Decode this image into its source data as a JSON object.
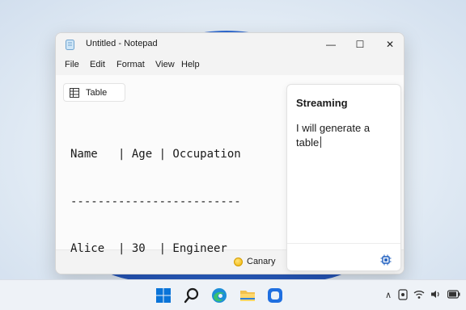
{
  "window": {
    "title": "Untitled - Notepad",
    "controls": {
      "minimize": "—",
      "maximize": "☐",
      "close": "✕"
    }
  },
  "menu": [
    "File",
    "Edit",
    "Format",
    "View",
    "Help"
  ],
  "toolbar": {
    "table_label": "Table"
  },
  "editor": {
    "lines": [
      "Name   | Age | Occupation",
      "-------------------------",
      "Alice  | 30  | Engineer"
    ]
  },
  "status": {
    "channel": "Canary"
  },
  "panel": {
    "title": "Streaming",
    "text": "I will generate a table"
  },
  "taskbar": {
    "icons": [
      "windows-start-icon",
      "search-icon",
      "edge-browser-icon",
      "file-explorer-icon",
      "copilot-app-icon"
    ],
    "tray": [
      "chevron-up-icon",
      "security-icon",
      "wifi-icon",
      "volume-icon",
      "battery-icon"
    ]
  },
  "colors": {
    "accent": "#0067c0",
    "canary": "#f0b400",
    "wallpaper_bloom": "#2b6fe0"
  }
}
